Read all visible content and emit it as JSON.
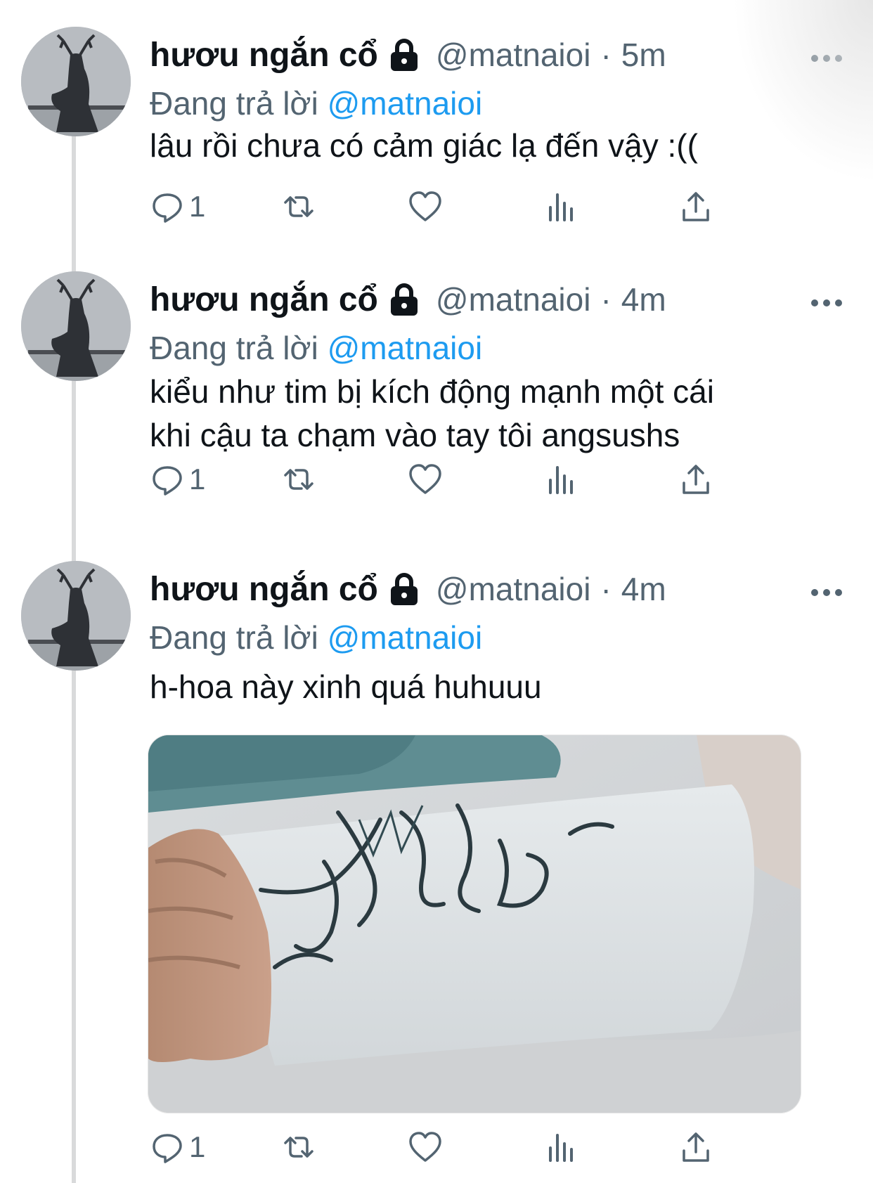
{
  "tweets": [
    {
      "author": "hươu ngắn cổ",
      "handle": "@matnaioi",
      "separator": "·",
      "time": "5m",
      "replying_prefix": "Đang trả lời",
      "replying_to": "@matnaioi",
      "text_lines": [
        "lâu rồi chưa có cảm giác lạ đến vậy :(("
      ],
      "reply_count": "1"
    },
    {
      "author": "hươu ngắn cổ",
      "handle": "@matnaioi",
      "separator": "·",
      "time": "4m",
      "replying_prefix": "Đang trả lời",
      "replying_to": "@matnaioi",
      "text_lines": [
        "kiểu như tim bị kích động mạnh một cái",
        "khi cậu ta chạm vào tay tôi angsushs"
      ],
      "reply_count": "1"
    },
    {
      "author": "hươu ngắn cổ",
      "handle": "@matnaioi",
      "separator": "·",
      "time": "4m",
      "replying_prefix": "Đang trả lời",
      "replying_to": "@matnaioi",
      "text_lines": [
        "h-hoa này xinh quá huhuuu"
      ],
      "reply_count": "1"
    }
  ],
  "icons": {
    "reply": "speech-bubble-icon",
    "retweet": "retweet-arrows-icon",
    "like": "heart-icon",
    "analytics": "bar-chart-icon",
    "share": "share-upload-icon",
    "more": "ellipsis-icon",
    "protected": "lock-icon"
  },
  "colors": {
    "link": "#1d9bf0",
    "secondary_text": "#536471",
    "primary_text": "#0f1419",
    "thread_line": "#d9dadb"
  }
}
